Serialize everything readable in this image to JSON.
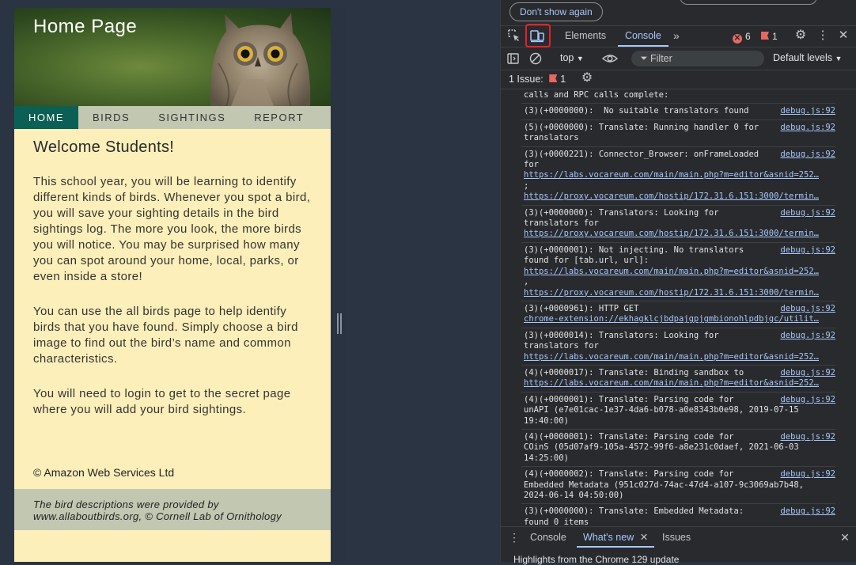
{
  "website": {
    "hero_title": "Home Page",
    "nav": [
      "HOME",
      "BIRDS",
      "SIGHTINGS",
      "REPORT"
    ],
    "welcome": "Welcome Students!",
    "paragraphs": [
      "This school year, you will be learning to identify different kinds of birds. Whenever you spot a bird, you will save your sighting details in the bird sightings log. The more you look, the more birds you will notice. You may be surprised how many you can spot around your home, local, parks, or even inside a store!",
      "You can use the all birds page to help identify birds that you have found. Simply choose a bird image to find out the bird’s name and common characteristics.",
      "You will need to login to get to the secret page where you will add your bird sightings."
    ],
    "copyright": "© Amazon Web Services Ltd",
    "credit": "The bird descriptions were provided by www.allaboutbirds.org, © Cornell Lab of Ornithology"
  },
  "devtools": {
    "banner_button": "Don't show again",
    "tabs": {
      "elements": "Elements",
      "console": "Console"
    },
    "error_count": "6",
    "issue_count": "1",
    "context": "top",
    "filter_placeholder": "Filter",
    "levels": "Default levels",
    "issues_text": "1 Issue:",
    "issues_count_small": "1",
    "drawer": {
      "console": "Console",
      "whats_new": "What's new",
      "issues": "Issues",
      "highlight": "Highlights from the Chrome 129 update"
    },
    "log": [
      {
        "text": "calls and RPC calls complete:",
        "src": "",
        "links": []
      },
      {
        "text": "(3)(+0000000):  No suitable translators found",
        "src": "debug.js:92",
        "links": []
      },
      {
        "text": "(5)(+0000000): Translate: Running handler 0 for\ntranslators",
        "src": "debug.js:92",
        "links": []
      },
      {
        "text": "(3)(+0000221): Connector_Browser: onFrameLoaded\nfor",
        "src": "debug.js:92",
        "links": [
          "https://labs.vocareum.com/main/main.php?m=editor&asnid=252…",
          ";",
          "https://proxy.vocareum.com/hostip/172.31.6.151:3000/termin…"
        ]
      },
      {
        "text": "(3)(+0000000): Translators: Looking for\ntranslators for",
        "src": "debug.js:92",
        "links": [
          "https://proxy.vocareum.com/hostip/172.31.6.151:3000/termin…"
        ]
      },
      {
        "text": "(3)(+0000001): Not injecting. No translators\nfound for [tab.url, url]:",
        "src": "debug.js:92",
        "links": [
          "https://labs.vocareum.com/main/main.php?m=editor&asnid=252…",
          ",",
          "https://proxy.vocareum.com/hostip/172.31.6.151:3000/termin…"
        ]
      },
      {
        "text": "(3)(+0000961): HTTP GET",
        "src": "debug.js:92",
        "links": [
          "chrome-extension://ekhagklcjbdpajgpjgmbionohlpdbjgc/utilit…"
        ]
      },
      {
        "text": "(3)(+0000014): Translators: Looking for\ntranslators for",
        "src": "debug.js:92",
        "links": [
          "https://labs.vocareum.com/main/main.php?m=editor&asnid=252…"
        ]
      },
      {
        "text": "(4)(+0000017): Translate: Binding sandbox to",
        "src": "debug.js:92",
        "links": [
          "https://labs.vocareum.com/main/main.php?m=editor&asnid=252…"
        ]
      },
      {
        "text": "(4)(+0000001): Translate: Parsing code for\nunAPI (e7e01cac-1e37-4da6-b078-a0e8343b0e98, 2019-07-15\n19:40:00)",
        "src": "debug.js:92",
        "links": []
      },
      {
        "text": "(4)(+0000001): Translate: Parsing code for\nCOinS (05d07af9-105a-4572-99f6-a8e231c0daef, 2021-06-03\n14:25:00)",
        "src": "debug.js:92",
        "links": []
      },
      {
        "text": "(4)(+0000002): Translate: Parsing code for\nEmbedded Metadata (951c027d-74ac-47d4-a107-9c3069ab7b48,\n2024-06-14 04:50:00)",
        "src": "debug.js:92",
        "links": []
      },
      {
        "text": "(3)(+0000000): Translate: Embedded Metadata:\nfound 0 items",
        "src": "debug.js:92",
        "links": []
      }
    ]
  }
}
